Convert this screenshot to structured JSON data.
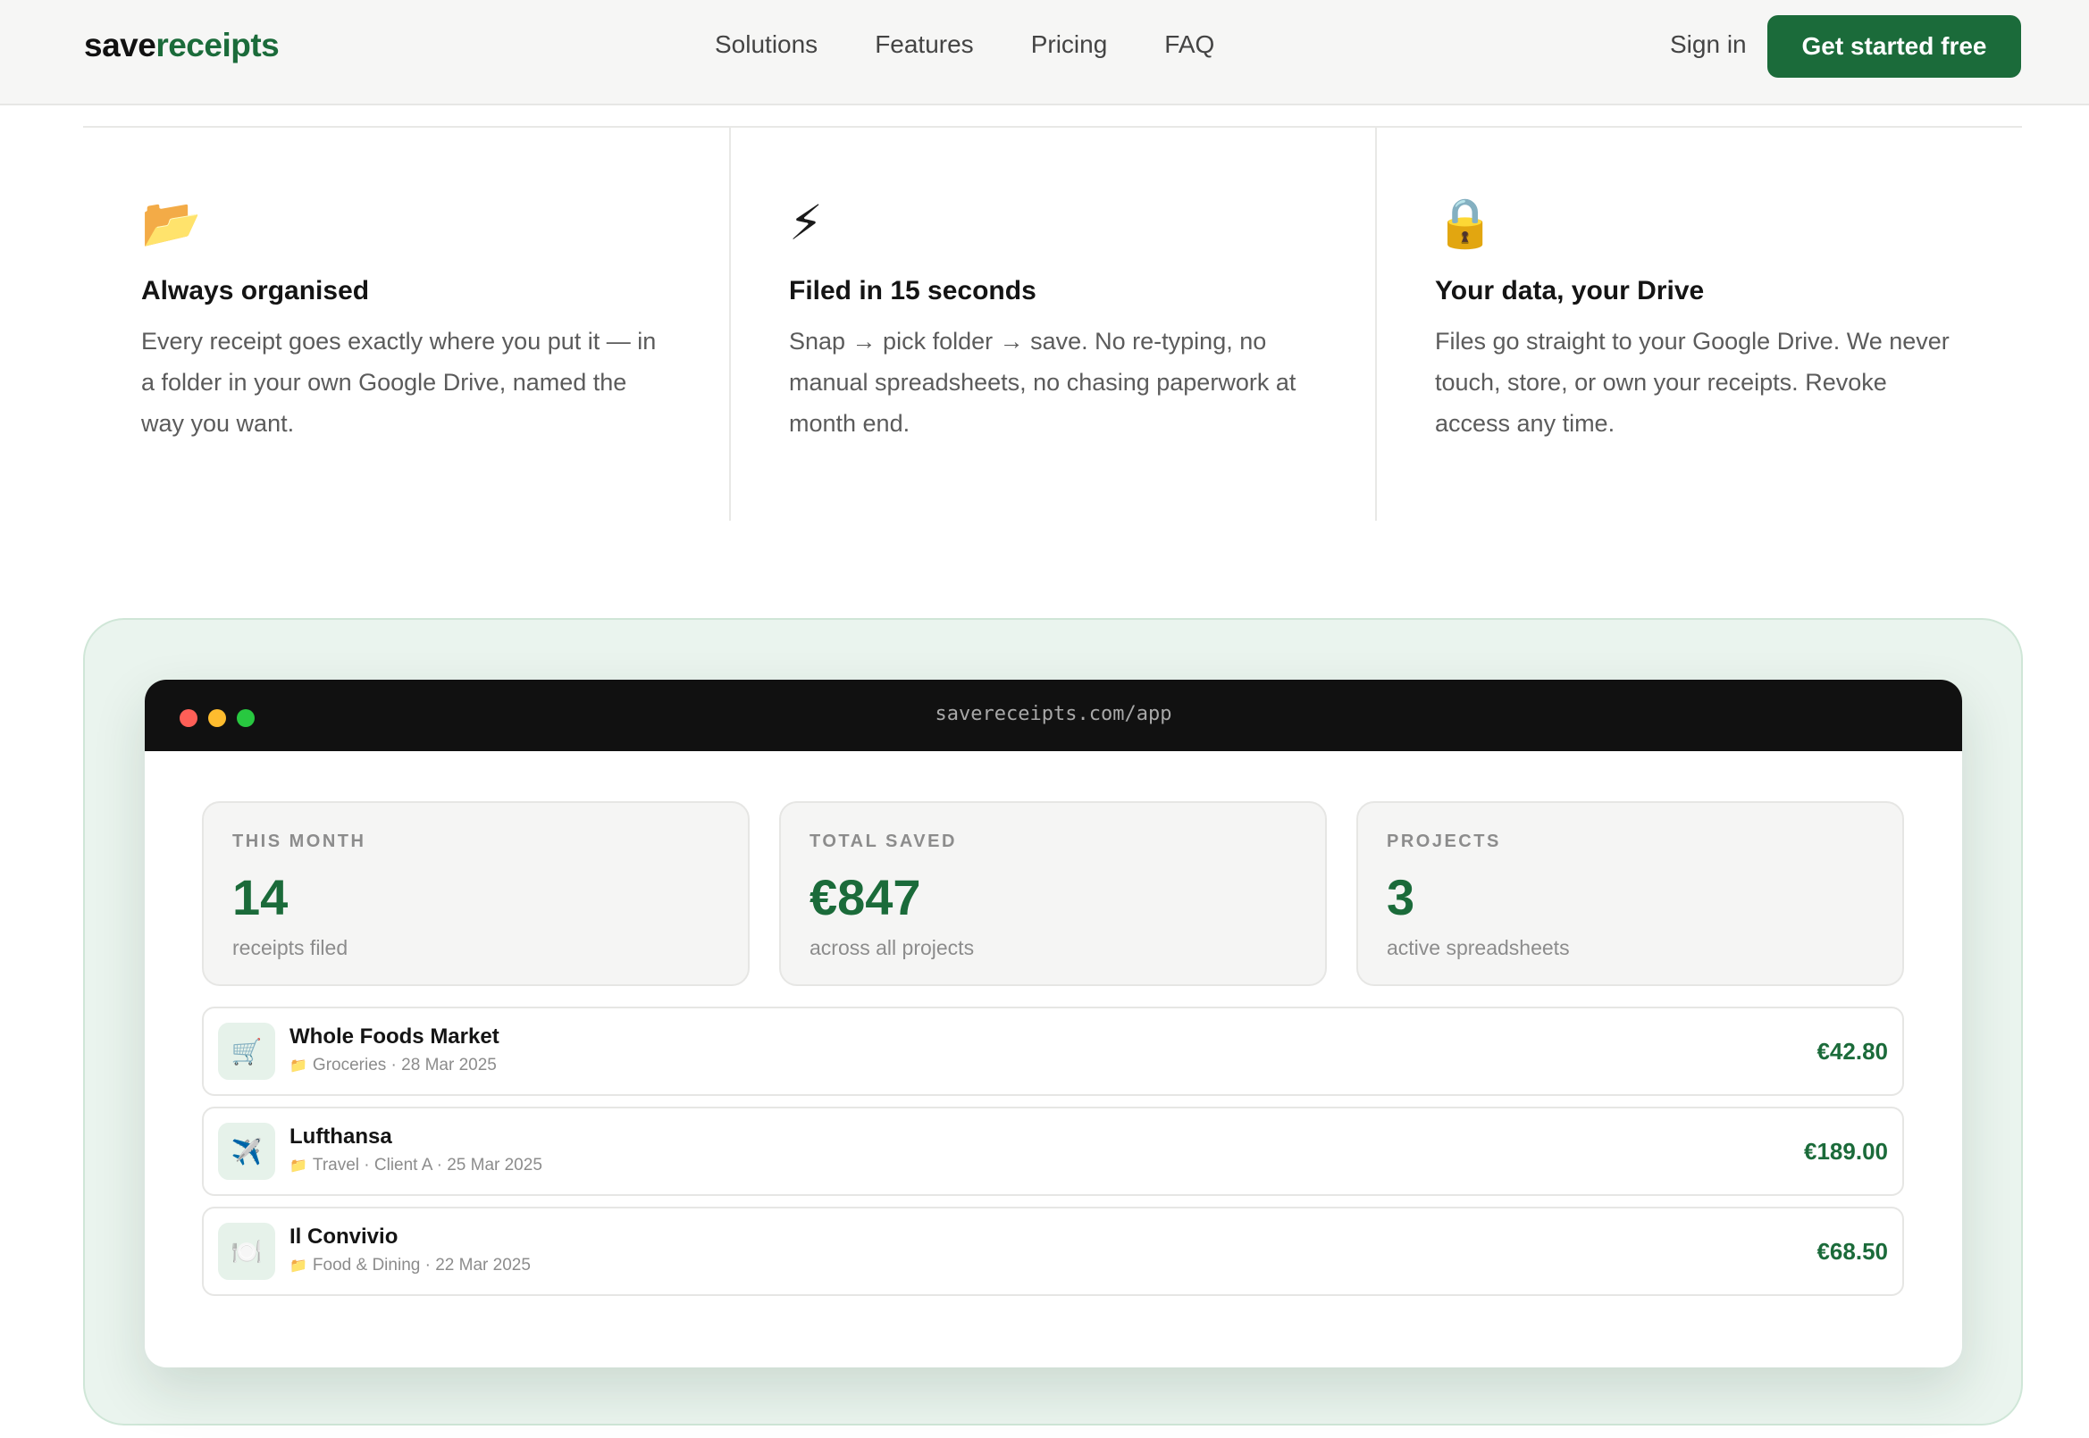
{
  "nav": {
    "logo_part1": "save",
    "logo_part2": "receipts",
    "links": [
      "Solutions",
      "Features",
      "Pricing",
      "FAQ"
    ],
    "sign_in": "Sign in",
    "cta": "Get started free"
  },
  "features": [
    {
      "icon": "📂",
      "icon_name": "folder-icon",
      "title": "Always organised",
      "body": "Every receipt goes exactly where you put it — in a folder in your own Google Drive, named the way you want."
    },
    {
      "icon": "⚡",
      "icon_name": "lightning-icon",
      "title": "Filed in 15 seconds",
      "body": "Snap → pick folder → save. No re-typing, no manual spreadsheets, no chasing paperwork at month end."
    },
    {
      "icon": "🔒",
      "icon_name": "lock-icon",
      "title": "Your data, your Drive",
      "body": "Files go straight to your Google Drive. We never touch, store, or own your receipts. Revoke access any time."
    }
  ],
  "app": {
    "url": "savereceipts.com/app",
    "stats": [
      {
        "label": "THIS MONTH",
        "value": "14",
        "sub": "receipts filed"
      },
      {
        "label": "TOTAL SAVED",
        "value": "€847",
        "sub": "across all projects"
      },
      {
        "label": "PROJECTS",
        "value": "3",
        "sub": "active spreadsheets"
      }
    ],
    "receipts": [
      {
        "icon": "🛒",
        "icon_name": "cart-icon",
        "name": "Whole Foods Market",
        "folder_icon": "📁",
        "meta": "Groceries · 28 Mar 2025",
        "amount": "€42.80"
      },
      {
        "icon": "✈️",
        "icon_name": "airplane-icon",
        "name": "Lufthansa",
        "folder_icon": "📁",
        "meta": "Travel · Client A · 25 Mar 2025",
        "amount": "€189.00"
      },
      {
        "icon": "🍽️",
        "icon_name": "plate-icon",
        "name": "Il Convivio",
        "folder_icon": "📁",
        "meta": "Food & Dining · 22 Mar 2025",
        "amount": "€68.50"
      }
    ]
  },
  "colors": {
    "brand_green": "#1b6b3a",
    "showcase_bg": "#eaf4ee",
    "titlebar": "#111111"
  }
}
